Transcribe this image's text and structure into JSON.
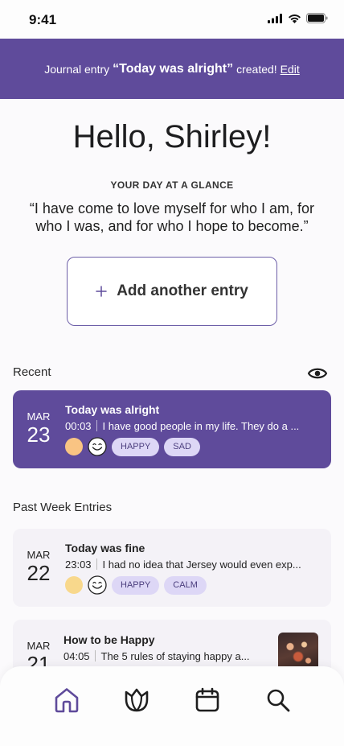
{
  "status": {
    "time": "9:41"
  },
  "toast": {
    "prefix": "Journal entry",
    "title": "“Today was alright”",
    "suffix": "created!",
    "edit": "Edit"
  },
  "greeting": "Hello, Shirley!",
  "glance_label": "YOUR DAY AT A GLANCE",
  "quote": "“I have come to love myself for who I am, for who I was, and for who I hope to become.”",
  "add_entry": {
    "label": "Add another entry",
    "icon": "plus-icon"
  },
  "recent": {
    "title": "Recent",
    "icon": "eye-icon",
    "entry": {
      "month": "MAR",
      "day": "23",
      "title": "Today was alright",
      "time": "00:03",
      "preview": "I have good people in my life. They do a ...",
      "mood_color": "#f9c483",
      "tags": [
        "HAPPY",
        "SAD"
      ]
    }
  },
  "past_week": {
    "title": "Past Week Entries",
    "entries": [
      {
        "month": "MAR",
        "day": "22",
        "title": "Today was fine",
        "time": "23:03",
        "preview": "I had no idea that Jersey would even exp...",
        "mood_color": "#f8d88c",
        "tags": [
          "HAPPY",
          "CALM"
        ]
      },
      {
        "month": "MAR",
        "day": "21",
        "title": "How to be Happy",
        "time": "04:05",
        "preview": "The 5 rules of staying happy a..."
      }
    ]
  },
  "nav": {
    "items": [
      "home-icon",
      "lotus-icon",
      "calendar-icon",
      "search-icon"
    ],
    "accent": "#5f4b9b"
  },
  "colors": {
    "brand": "#5f4b9b",
    "tag_bg": "#ddd7f6",
    "card_bg": "#f4f2f7"
  }
}
